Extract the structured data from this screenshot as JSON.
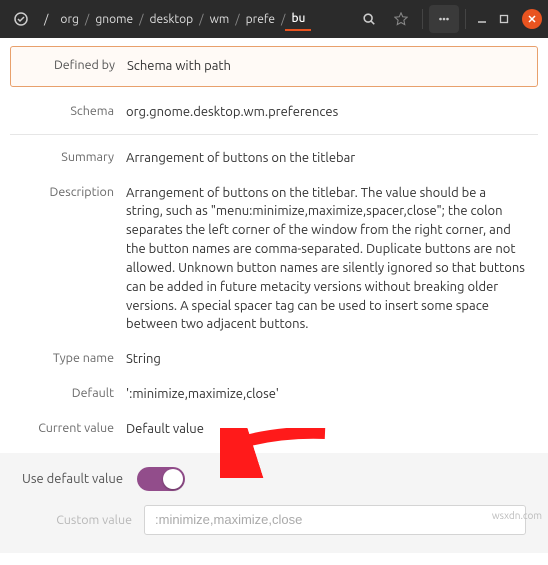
{
  "header": {
    "breadcrumbs": [
      "/",
      "org",
      "gnome",
      "desktop",
      "wm",
      "prefe",
      "bu"
    ],
    "active_crumb_index": 7
  },
  "rows": {
    "defined_by": {
      "label": "Defined by",
      "value": "Schema with path"
    },
    "schema": {
      "label": "Schema",
      "value": "org.gnome.desktop.wm.preferences"
    },
    "summary": {
      "label": "Summary",
      "value": "Arrangement of buttons on the titlebar"
    },
    "description": {
      "label": "Description",
      "value": "Arrangement of buttons on the titlebar. The value should be a string, such as \"menu:minimize,maximize,spacer,close\"; the colon separates the left corner of the window from the right corner, and the button names are comma-separated. Duplicate buttons are not allowed. Unknown button names are silently ignored so that buttons can be added in future metacity versions without breaking older versions. A special spacer tag can be used to insert some space between two adjacent buttons."
    },
    "type_name": {
      "label": "Type name",
      "value": "String"
    },
    "default": {
      "label": "Default",
      "value": "':minimize,maximize,close'"
    },
    "current": {
      "label": "Current value",
      "value": "Default value"
    }
  },
  "toggle": {
    "label": "Use default value",
    "on": true
  },
  "custom": {
    "label": "Custom value",
    "placeholder": ":minimize,maximize,close"
  },
  "watermark": "wsxdn.com"
}
